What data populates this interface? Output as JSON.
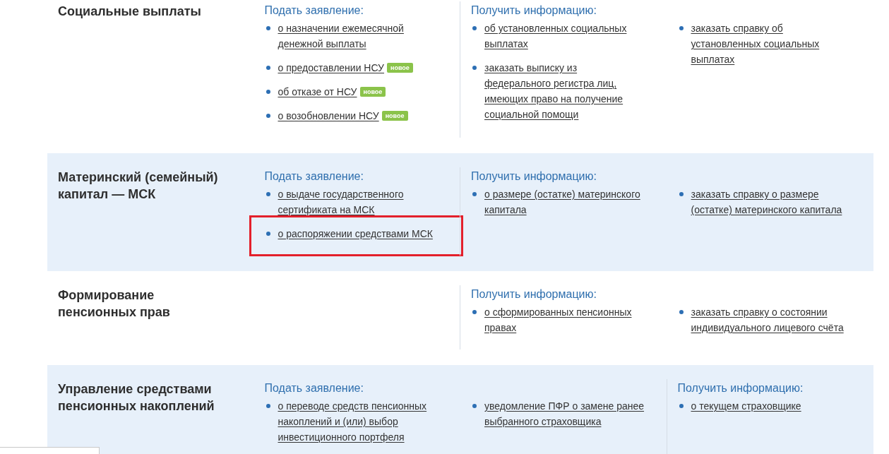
{
  "sections": [
    {
      "title": "Социальные выплаты",
      "shaded": false,
      "apply": {
        "heading": "Подать заявление:",
        "columns": [
          [
            {
              "text": "о назначении ежемесячной денежной выплаты",
              "highlighted": false
            },
            {
              "text": "о предоставлении НСУ",
              "badge": "новое",
              "highlighted": false
            },
            {
              "text": "об отказе от НСУ",
              "badge": "новое",
              "highlighted": false
            },
            {
              "text": "о возобновлении НСУ",
              "badge": "новое",
              "highlighted": false
            }
          ]
        ]
      },
      "info": {
        "heading": "Получить информацию:",
        "columns": [
          [
            {
              "text": "об установленных социальных выплатах",
              "highlighted": false
            },
            {
              "text": "заказать выписку из федерального регистра лиц, имеющих право на получение социальной помощи",
              "highlighted": false
            }
          ],
          [
            {
              "text": "заказать справку об установленных социальных выплатах",
              "highlighted": false
            }
          ]
        ]
      }
    },
    {
      "title": "Материнский (семейный) капитал — МСК",
      "shaded": true,
      "apply": {
        "heading": "Подать заявление:",
        "columns": [
          [
            {
              "text": "о выдаче государственного сертификата на МСК",
              "highlighted": false
            },
            {
              "text": "о распоряжении средствами МСК",
              "highlighted": true
            }
          ]
        ]
      },
      "info": {
        "heading": "Получить информацию:",
        "columns": [
          [
            {
              "text": "о размере (остатке) материнского капитала",
              "highlighted": false
            }
          ],
          [
            {
              "text": "заказать справку о размере (остатке) материнского капитала",
              "highlighted": false
            }
          ]
        ]
      }
    },
    {
      "title": "Формирование пенсионных прав",
      "shaded": false,
      "info": {
        "heading": "Получить информацию:",
        "columns": [
          [
            {
              "text": "о сформированных пенсионных правах",
              "highlighted": false
            }
          ],
          [
            {
              "text": "заказать справку о состоянии индивидуального лицевого счёта",
              "highlighted": false
            }
          ]
        ]
      }
    },
    {
      "title": "Управление средствами пенсионных накоплений",
      "shaded": true,
      "apply": {
        "heading": "Подать заявление:",
        "columns": [
          [
            {
              "text": "о переводе средств пенсионных накоплений и (или) выбор инвестиционного портфеля",
              "highlighted": false
            }
          ],
          [
            {
              "text": "уведомление ПФР о замене ранее выбранного страховщика",
              "highlighted": false
            }
          ]
        ]
      },
      "info": {
        "heading": "Получить информацию:",
        "columns": [
          [
            {
              "text": "о текущем страховщике",
              "highlighted": false
            }
          ]
        ]
      }
    }
  ]
}
